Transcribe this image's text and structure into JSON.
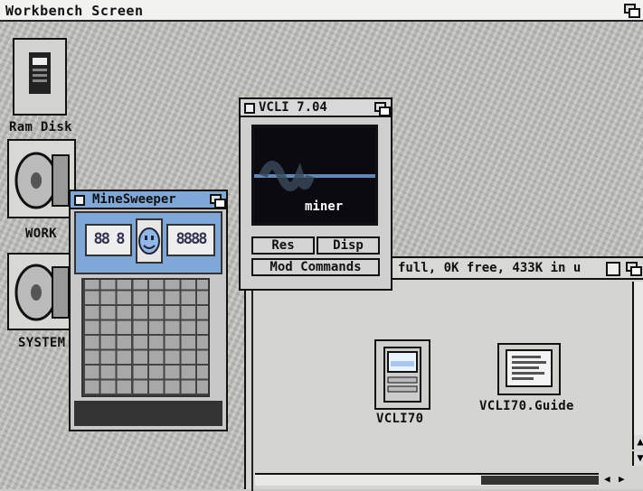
{
  "screen": {
    "title": "Workbench Screen"
  },
  "desktop_icons": [
    {
      "label": "Ram Disk"
    },
    {
      "label": "WORK"
    },
    {
      "label": "SYSTEM"
    }
  ],
  "minesweeper": {
    "title": "MineSweeper",
    "left_counter": "88 8",
    "right_counter": "8888"
  },
  "vcli": {
    "title": "VCLI 7.04",
    "display_text": "miner",
    "res_label": "Res",
    "disp_label": "Disp",
    "mod_label": "Mod Commands"
  },
  "drawer": {
    "status": "full, 0K free, 433K in u",
    "icons": [
      {
        "label": "VCLI70"
      },
      {
        "label": "VCLI70.Guide"
      }
    ]
  },
  "colors": {
    "accent_blue": "#7fa8d8",
    "smiley": "#8fb8e8"
  }
}
